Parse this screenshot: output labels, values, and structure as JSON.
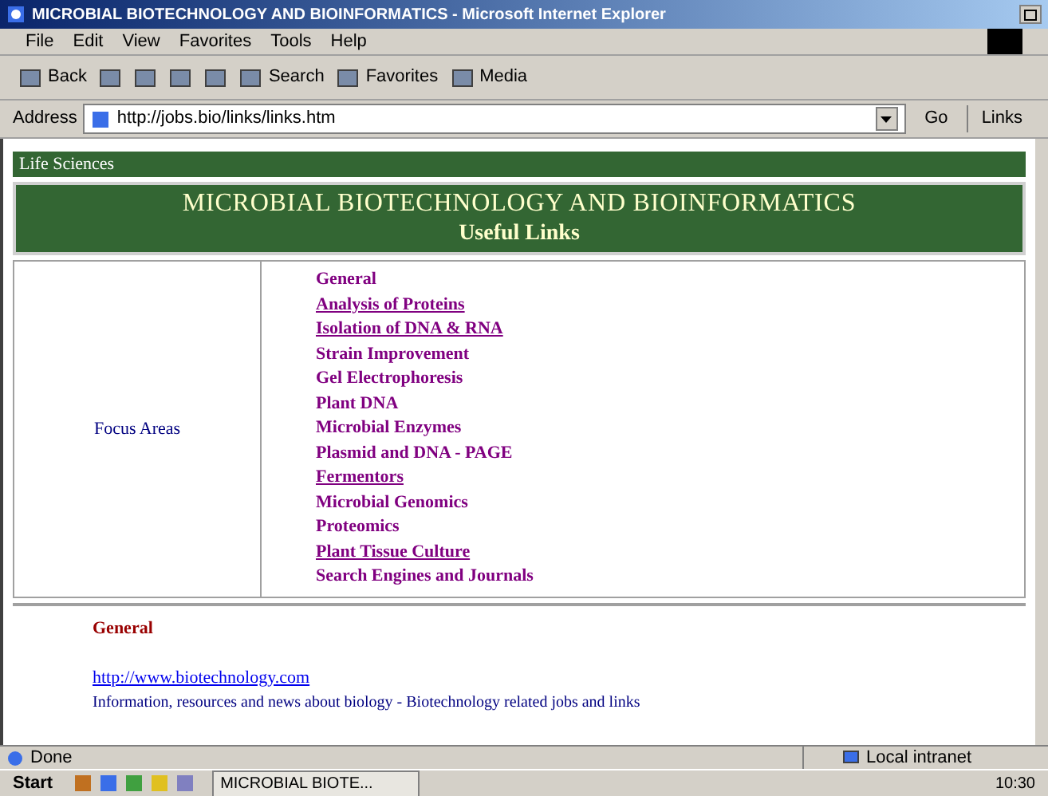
{
  "window": {
    "title": "MICROBIAL BIOTECHNOLOGY AND BIOINFORMATICS - Microsoft Internet Explorer"
  },
  "menu": [
    "File",
    "Edit",
    "View",
    "Favorites",
    "Tools",
    "Help"
  ],
  "toolbar": [
    {
      "kind": "labeled",
      "label": "Back"
    },
    {
      "kind": "icon"
    },
    {
      "kind": "icon"
    },
    {
      "kind": "icon"
    },
    {
      "kind": "icon"
    },
    {
      "kind": "labeled",
      "label": "Search"
    },
    {
      "kind": "labeled",
      "label": "Favorites"
    },
    {
      "kind": "labeled",
      "label": "Media"
    }
  ],
  "address": {
    "label": "Address",
    "value": "http://jobs.bio/links/links.htm",
    "go": "Go",
    "links": "Links"
  },
  "page": {
    "section": "Life Sciences",
    "title": "MICROBIAL BIOTECHNOLOGY AND BIOINFORMATICS",
    "subtitle": "Useful Links",
    "focus_label": "Focus Areas",
    "links": [
      {
        "text": "General",
        "underlined": false
      },
      {
        "text": "Analysis of Proteins",
        "underlined": true
      },
      {
        "text": "Isolation of DNA & RNA",
        "underlined": true
      },
      {
        "text": "Strain Improvement",
        "underlined": false
      },
      {
        "text": "Gel Electrophoresis",
        "underlined": false
      },
      {
        "text": "Plant DNA",
        "underlined": false
      },
      {
        "text": "Microbial Enzymes",
        "underlined": false
      },
      {
        "text": "Plasmid and DNA - PAGE",
        "underlined": false
      },
      {
        "text": "Fermentors",
        "underlined": true
      },
      {
        "text": "Microbial Genomics",
        "underlined": false
      },
      {
        "text": "Proteomics",
        "underlined": false
      },
      {
        "text": "Plant Tissue Culture",
        "underlined": true
      },
      {
        "text": "Search Engines and Journals",
        "underlined": false
      }
    ],
    "general": {
      "heading": "General",
      "link": "http://www.biotechnology.com",
      "description": "Information, resources and news about biology - Biotechnology related jobs and links"
    }
  },
  "status_bar": {
    "text": "Done",
    "zone": "Local intranet"
  },
  "taskbar": {
    "start": "Start",
    "task": "MICROBIAL BIOTE...",
    "clock": "10:30"
  }
}
